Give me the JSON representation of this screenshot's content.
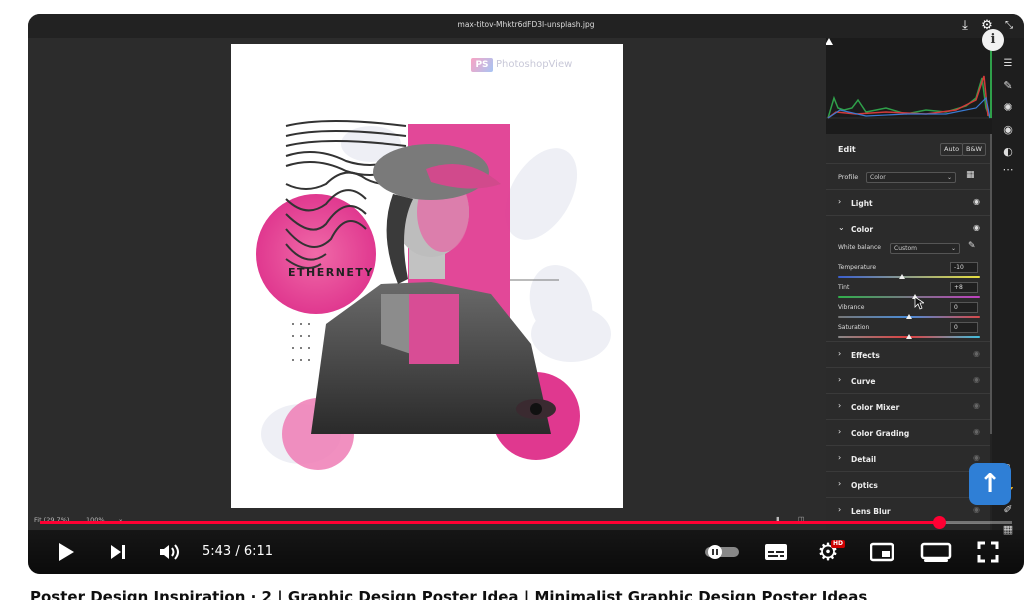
{
  "player": {
    "filename": "max-titov-Mhktr6dFD3I-unsplash.jpg",
    "titlebar_icons": [
      "download-icon",
      "gear-icon",
      "collapse-icon"
    ],
    "info_label": "i"
  },
  "artboard": {
    "watermark_badge": "PS",
    "watermark_text": "PhotoshopView",
    "poster_text": "ETHERNETY"
  },
  "panel": {
    "edit_title": "Edit",
    "auto_label": "Auto",
    "bw_label": "B&W",
    "profile_label": "Profile",
    "profile_value": "Color",
    "sections_top": [
      {
        "arrow": "›",
        "title": "Light"
      }
    ],
    "color_section": {
      "arrow": "⌄",
      "title": "Color",
      "white_balance_label": "White balance",
      "white_balance_value": "Custom",
      "sliders": [
        {
          "label": "Temperature",
          "value": "-10",
          "level": 0.45
        },
        {
          "label": "Tint",
          "value": "+8",
          "level": 0.54
        },
        {
          "label": "Vibrance",
          "value": "0",
          "level": 0.5
        },
        {
          "label": "Saturation",
          "value": "0",
          "level": 0.5
        }
      ]
    },
    "sections_bottom": [
      {
        "arrow": "›",
        "title": "Effects"
      },
      {
        "arrow": "›",
        "title": "Curve"
      },
      {
        "arrow": "›",
        "title": "Color Mixer"
      },
      {
        "arrow": "›",
        "title": "Color Grading"
      },
      {
        "arrow": "›",
        "title": "Detail"
      },
      {
        "arrow": "›",
        "title": "Optics"
      },
      {
        "arrow": "›",
        "title": "Lens Blur"
      }
    ]
  },
  "zoom": {
    "fit_label": "Fit (29.7%)",
    "hundred_label": "100%"
  },
  "playback": {
    "time": "5:43 / 6:11",
    "progress": 0.925,
    "hd_badge": "HD"
  },
  "colors": {
    "progress": "#ff0033",
    "accent_blue": "#2f7fd6",
    "magenta": "#e0388f"
  },
  "video_title": "Poster Design Inspiration · 2 | Graphic Design Poster Idea | Minimalist Graphic Design Poster Ideas"
}
